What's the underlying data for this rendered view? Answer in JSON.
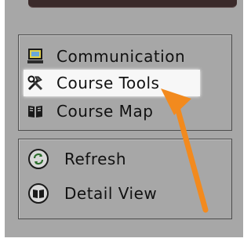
{
  "menu_primary": {
    "items": [
      {
        "label": "Communication",
        "icon": "monitor-icon"
      },
      {
        "label": "Course Tools",
        "icon": "tools-icon",
        "highlighted": true
      },
      {
        "label": "Course Map",
        "icon": "book-icon"
      }
    ]
  },
  "menu_secondary": {
    "items": [
      {
        "label": "Refresh",
        "icon": "refresh-icon"
      },
      {
        "label": "Detail View",
        "icon": "detail-view-icon"
      }
    ]
  },
  "annotation": {
    "arrow_color": "#f28a1e"
  },
  "colors": {
    "panel": "#a7a7a7",
    "highlight": "#f7f7f7"
  }
}
